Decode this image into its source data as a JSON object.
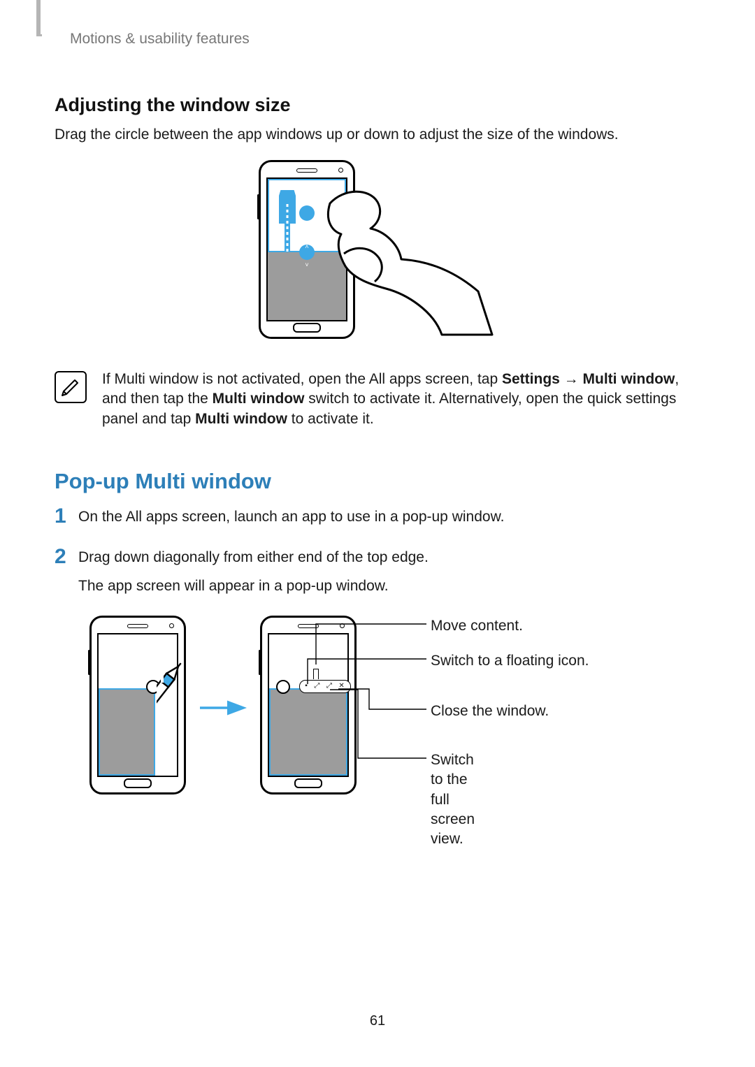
{
  "breadcrumb": "Motions & usability features",
  "section1": {
    "heading": "Adjusting the window size",
    "body": "Drag the circle between the app windows up or down to adjust the size of the windows."
  },
  "note": {
    "parts": [
      "If Multi window is not activated, open the All apps screen, tap ",
      "Settings",
      " → ",
      "Multi window",
      ", and then tap the ",
      "Multi window",
      " switch to activate it. Alternatively, open the quick settings panel and tap ",
      "Multi window",
      " to activate it."
    ]
  },
  "section2": {
    "heading": "Pop-up Multi window",
    "steps": [
      {
        "num": "1",
        "lines": [
          "On the All apps screen, launch an app to use in a pop-up window."
        ]
      },
      {
        "num": "2",
        "lines": [
          "Drag down diagonally from either end of the top edge.",
          "The app screen will appear in a pop-up window."
        ]
      }
    ]
  },
  "callouts": {
    "move": "Move content.",
    "floating": "Switch to a floating icon.",
    "close": "Close the window.",
    "full": "Switch to the full screen view."
  },
  "popup_controls": {
    "a": "▪",
    "b": "⤢",
    "c": "⤢",
    "d": "✕"
  },
  "pagenum": "61"
}
